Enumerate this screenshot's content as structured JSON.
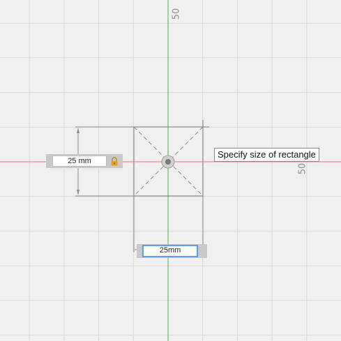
{
  "ruler": {
    "top_value": "50",
    "right_value": "50"
  },
  "dimensions": {
    "height_value": "25 mm",
    "width_value": "25mm"
  },
  "tooltip": {
    "text": "Specify size of rectangle"
  },
  "colors": {
    "background": "#f0f0f0",
    "grid_line": "#d8d8d8",
    "x_axis": "#e57373",
    "y_axis": "#4caf50",
    "sketch_line": "#7a7a7a",
    "active_input_border": "#5b9ee6",
    "lock": "#e3a21a"
  },
  "icons": {
    "lock": "lock-icon",
    "origin": "origin-point-icon"
  }
}
